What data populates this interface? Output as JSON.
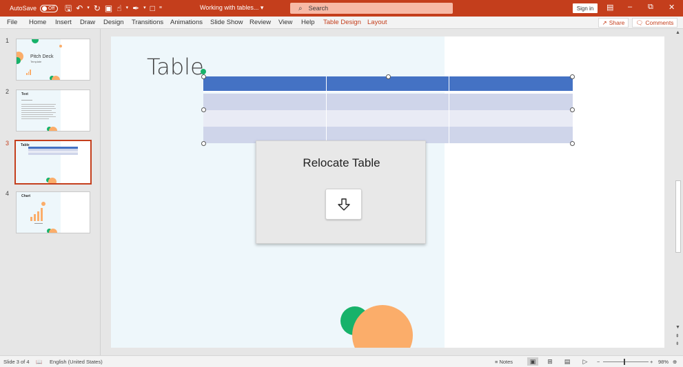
{
  "titlebar": {
    "autosave_label": "AutoSave",
    "autosave_state": "Off",
    "doc_title": "Working with tables...",
    "search_placeholder": "Search",
    "signin_label": "Sign in",
    "bg_color": "#c43e1c"
  },
  "ribbon": {
    "tabs": [
      "File",
      "Home",
      "Insert",
      "Draw",
      "Design",
      "Transitions",
      "Animations",
      "Slide Show",
      "Review",
      "View",
      "Help",
      "Table Design",
      "Layout"
    ],
    "share_label": "Share",
    "comments_label": "Comments"
  },
  "thumbnails": [
    {
      "number": "1",
      "title": "Pitch Deck",
      "subtitle": "Template"
    },
    {
      "number": "2",
      "title": "Text"
    },
    {
      "number": "3",
      "title": "Table"
    },
    {
      "number": "4",
      "title": "Chart"
    }
  ],
  "slide": {
    "title": "Table",
    "table": {
      "rows": 4,
      "cols": 3,
      "header_color": "#4472c4",
      "band_dark": "#cfd5ea",
      "band_light": "#e9ebf5"
    }
  },
  "relocate_dialog": {
    "title": "Relocate Table",
    "button_icon": "arrow-down-icon"
  },
  "statusbar": {
    "slide_info": "Slide 3 of 4",
    "language": "English (United States)",
    "notes_label": "Notes",
    "zoom": "98%",
    "zoom_minus": "−",
    "zoom_plus": "+"
  }
}
